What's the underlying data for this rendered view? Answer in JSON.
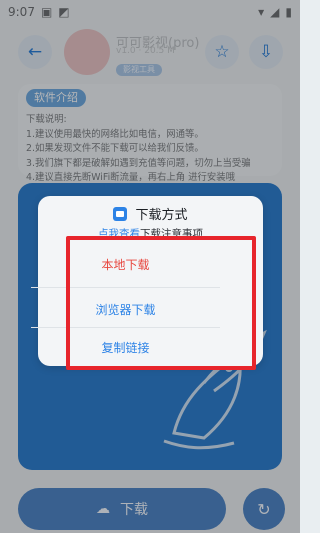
{
  "status_bar": {
    "time": "9:07"
  },
  "header": {
    "app_title": "可可影视(pro)",
    "app_meta": "v1.0  ·  20.5 M",
    "app_badge": "影视工具"
  },
  "intro": {
    "tag": "软件介绍",
    "lines": [
      "下载说明:",
      "1.建议使用最快的网络比如电信，网通等。",
      "2.如果发现文件不能下载可以给我们反馈。",
      "3.我们旗下都是破解如遇到充值等问题，切勿上当受骗",
      "4.建议直接先断WiFi断流量，再右上角 进行安装哦"
    ]
  },
  "dialog": {
    "title": "下载方式",
    "sub_link": "点我查看",
    "sub_rest": "下载注意事项",
    "options": [
      "本地下载",
      "浏览器下载",
      "复制链接"
    ]
  },
  "bottom": {
    "download_label": "下载"
  },
  "colors": {
    "accent": "#2d83e6",
    "danger": "#e8473f",
    "highlight_box": "#e7252c"
  }
}
